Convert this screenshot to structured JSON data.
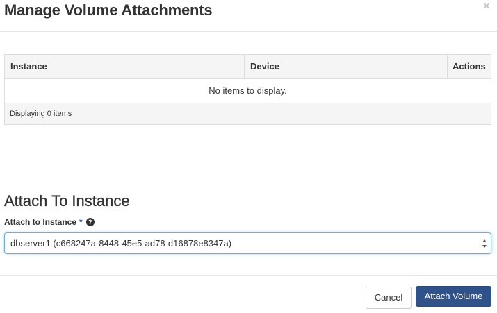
{
  "modal": {
    "title": "Manage Volume Attachments",
    "close_glyph": "×"
  },
  "attachments_table": {
    "columns": [
      "Instance",
      "Device",
      "Actions"
    ],
    "empty_message": "No items to display.",
    "footer": "Displaying 0 items"
  },
  "attach_section": {
    "title": "Attach To Instance",
    "field_label": "Attach to Instance",
    "required_marker": "*",
    "help_glyph": "?",
    "selected_instance": "dbserver1 (c668247a-8448-45e5-ad78-d16878e8347a)"
  },
  "footer_buttons": {
    "cancel_label": "Cancel",
    "submit_label": "Attach Volume"
  },
  "colors": {
    "primary": "#30528a",
    "focus_border": "#66afe9",
    "required": "#2a6496"
  },
  "icons": {
    "close": "close-icon",
    "help": "question-circle-icon",
    "select_arrows": "updown-arrows-icon"
  }
}
